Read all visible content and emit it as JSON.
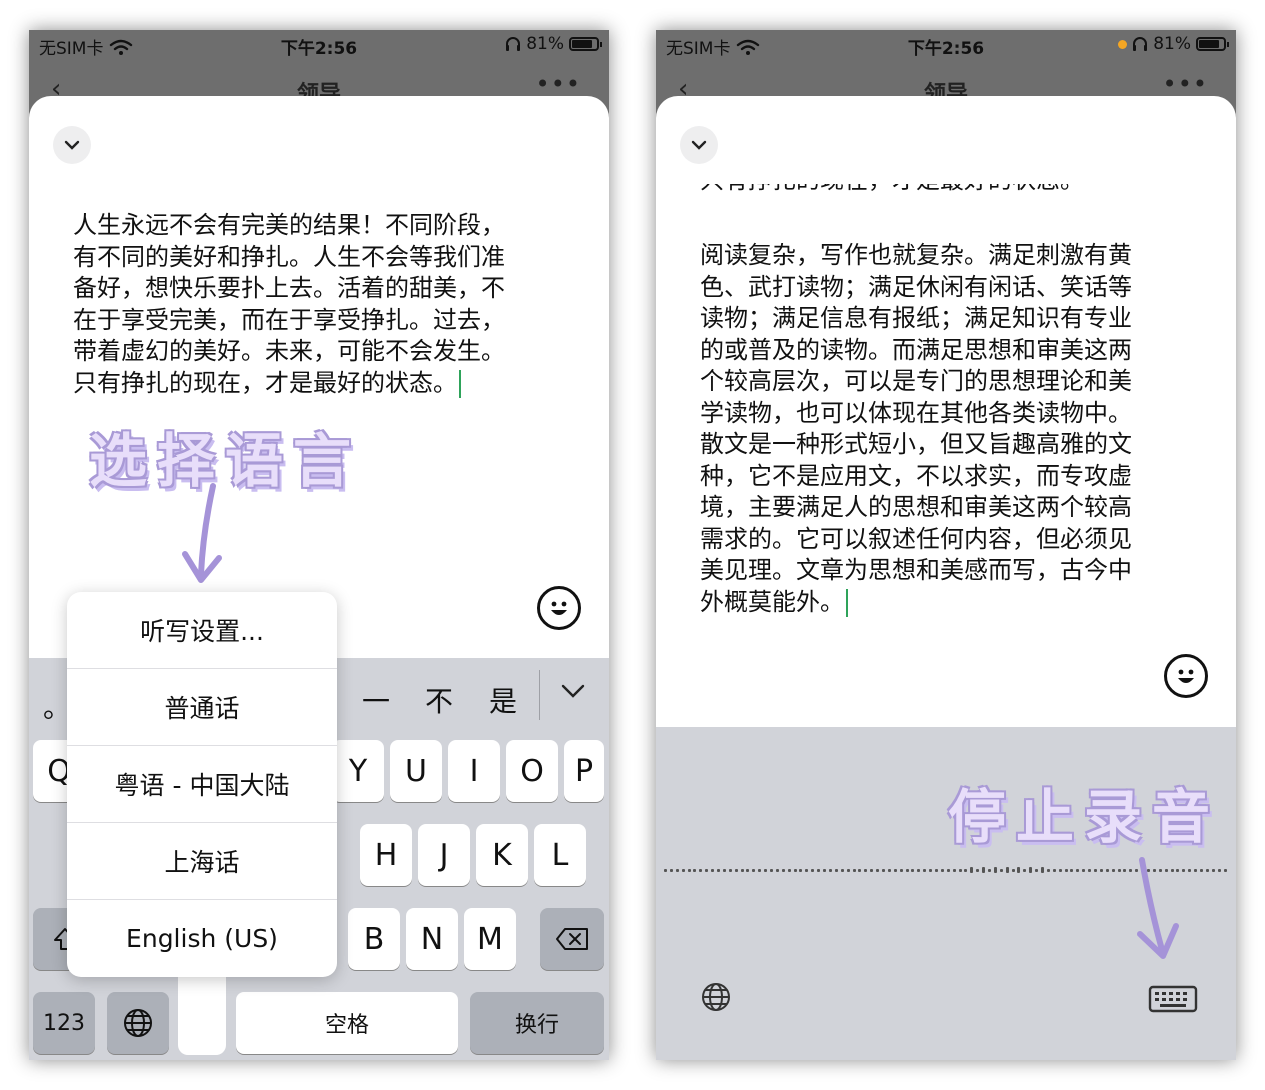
{
  "left": {
    "status": {
      "carrier": "无SIM卡",
      "time": "下午2:56",
      "battery": "81%"
    },
    "nav": {
      "back": "‹",
      "title": "领导",
      "more": "•••"
    },
    "editor_text": "人生永远不会有完美的结果！不同阶段，\n有不同的美好和挣扎。人生不会等我们准\n备好，想快乐要扑上去。活着的甜美，不\n在于享受完美，而在于享受挣扎。过去，\n带着虚幻的美好。未来，可能不会发生。\n只有挣扎的现在，才是最好的状态。",
    "annotation": "选择语言",
    "language_menu": [
      "听写设置...",
      "普通话",
      "粤语 - 中国大陆",
      "上海话",
      "English (US)"
    ],
    "candidates": [
      "。",
      "一",
      "不",
      "是"
    ],
    "keys_row1": [
      "Q",
      "Y",
      "U",
      "I",
      "O",
      "P"
    ],
    "keys_row2": [
      "H",
      "J",
      "K",
      "L"
    ],
    "keys_row3": [
      "B",
      "N",
      "M"
    ],
    "key_123": "123",
    "key_space": "空格",
    "key_return": "换行"
  },
  "right": {
    "status": {
      "carrier": "无SIM卡",
      "time": "下午2:56",
      "battery": "81%"
    },
    "nav": {
      "back": "‹",
      "title": "领导",
      "more": "•••"
    },
    "editor_partial_line": "只有挣扎的现在，才是最好的状态。",
    "editor_text": "阅读复杂，写作也就复杂。满足刺激有黄\n色、武打读物；满足休闲有闲话、笑话等\n读物；满足信息有报纸；满足知识有专业\n的或普及的读物。而满足思想和审美这两\n个较高层次，可以是专门的思想理论和美\n学读物，也可以体现在其他各类读物中。\n散文是一种形式短小，但又旨趣高雅的文\n种，它不是应用文，不以求实，而专攻虚\n境，主要满足人的思想和审美这两个较高\n需求的。它可以叙述任何内容，但必须见\n美见理。文章为思想和美感而写，古今中\n外概莫能外。",
    "annotation": "停止录音"
  },
  "icons": {
    "wifi": "wifi-icon",
    "headphones": "headphones-icon",
    "battery": "battery-icon",
    "chevron": "chevron-down-icon",
    "emoji": "emoji-icon",
    "globe": "globe-icon",
    "delete": "delete-icon",
    "shift": "shift-icon",
    "keyboard": "keyboard-icon"
  },
  "colors": {
    "annotation": "#e8defa",
    "annotation_outline": "#a99ad6",
    "arrow": "#a593d8",
    "caret": "#2ea35a",
    "keyboard_bg": "#d1d3d9",
    "mic_dot": "#f4a623"
  }
}
